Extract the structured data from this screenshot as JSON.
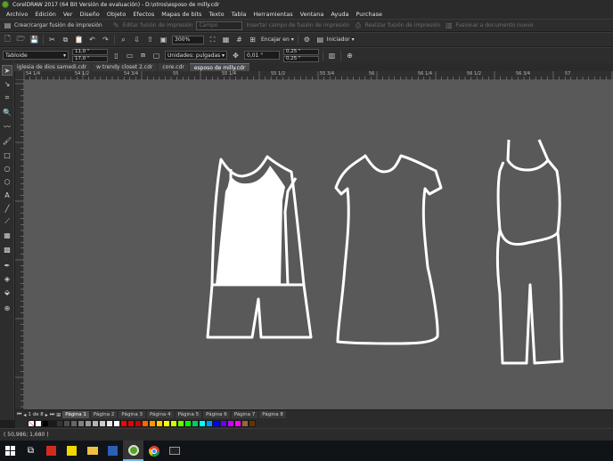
{
  "title": "CorelDRAW 2017 (64 Bit Versión de evaluación) - D:\\otros\\esposo de milly.cdr",
  "menu": [
    "Archivo",
    "Edición",
    "Ver",
    "Diseño",
    "Objeto",
    "Efectos",
    "Mapas de bits",
    "Texto",
    "Tabla",
    "Herramientas",
    "Ventana",
    "Ayuda",
    "Purchase"
  ],
  "cmdbar": {
    "create_merge": "Crear/cargar fusión de impresión",
    "edit_merge": "Editar fusión de impresión",
    "field": "Campo",
    "insert_field": "Insertar campo de fusión de impresión",
    "run_merge": "Realizar fusión de impresión",
    "doc_merge": "Fusionar a documento nuevo"
  },
  "toolbar2": {
    "zoom": "300%",
    "snap_label": "Encajar en",
    "launch_label": "Iniciador"
  },
  "toolbar3": {
    "paper": "Tabloide",
    "width": "11,0 \"",
    "height": "17,0 \"",
    "units_label": "Unidades: pulgadas",
    "nudge": "0,01 \"",
    "dup_x": "0,25 \"",
    "dup_y": "0,25 \""
  },
  "doc_tabs": [
    {
      "label": "iglesia de dios samedi.cdr",
      "active": false
    },
    {
      "label": "w trendy closet 2.cdr",
      "active": false
    },
    {
      "label": "core.cdr",
      "active": false
    },
    {
      "label": "esposo de milly.cdr",
      "active": true
    }
  ],
  "ruler_labels": [
    "54 1/4",
    "54 1/2",
    "54 3/4",
    "55",
    "55 1/4",
    "55 1/2",
    "55 3/4",
    "56",
    "56 1/4",
    "56 1/2",
    "56 3/4",
    "57"
  ],
  "page_nav": {
    "counter": "1 de 8",
    "pages": [
      "Página 1",
      "Página 2",
      "Página 3",
      "Página 4",
      "Página 5",
      "Página 6",
      "Página 7",
      "Página 8"
    ],
    "active_index": 0
  },
  "palette": [
    "#ffffff",
    "#000000",
    "#1a1a1a",
    "#333333",
    "#4d4d4d",
    "#666666",
    "#808080",
    "#999999",
    "#b3b3b3",
    "#cccccc",
    "#e6e6e6",
    "#ffffff",
    "#ff0000",
    "#e60000",
    "#cc0000",
    "#ff6600",
    "#ff9900",
    "#ffcc00",
    "#ffff00",
    "#ccff00",
    "#66ff00",
    "#00ff00",
    "#00cc66",
    "#00ffff",
    "#0099ff",
    "#0000ff",
    "#6600ff",
    "#cc00ff",
    "#ff00ff",
    "#996633",
    "#663300"
  ],
  "status": "( 50,986; 1,680 )",
  "colors": {
    "canvas": "#595959",
    "chrome": "#2d2d2d",
    "accent": "#3a7bd5"
  },
  "taskbar_icons": [
    "start-icon",
    "task-view-icon",
    "pdf-icon",
    "sticky-notes-icon",
    "file-explorer-icon",
    "word-icon",
    "coreldraw-icon",
    "chrome-icon",
    "command-prompt-icon"
  ]
}
